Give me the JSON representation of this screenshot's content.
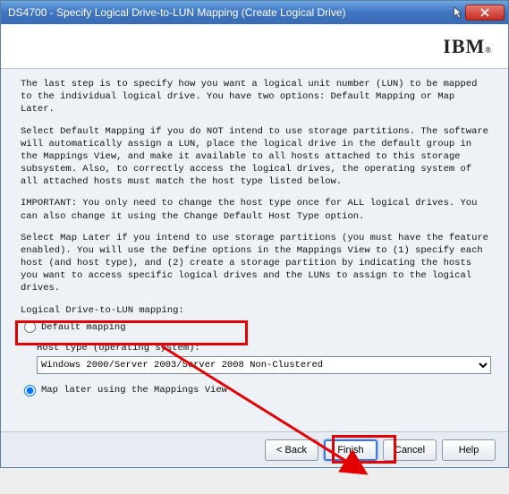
{
  "window": {
    "title": "DS4700 - Specify Logical Drive-to-LUN Mapping (Create Logical Drive)"
  },
  "brand": {
    "logo": "IBM"
  },
  "body": {
    "p1": "The last step is to specify how you want a logical unit number (LUN) to be mapped to the individual logical drive. You have two options: Default Mapping or Map Later.",
    "p2": "Select Default Mapping if you do NOT intend to use storage partitions. The software will automatically assign a LUN, place the logical drive in the default group in the Mappings View, and make it available to all hosts attached to this storage subsystem. Also, to correctly access the logical drives, the operating system of all attached hosts must match the host type listed below.",
    "p3": "IMPORTANT: You only need to change the host type once for ALL logical drives. You can also change it using the Change Default Host Type option.",
    "p4": "Select Map Later if you intend to use storage partitions (you must have the feature enabled). You will use the Define options in the Mappings View to (1) specify each host (and host type), and (2) create a storage partition by indicating the hosts you want to access specific logical drives and the LUNs to assign to the logical drives."
  },
  "form": {
    "section_label": "Logical Drive-to-LUN mapping:",
    "default_mapping_label": "Default mapping",
    "host_type_label": "Host type (operating system):",
    "host_type_value": "Windows 2000/Server 2003/Server 2008 Non-Clustered",
    "map_later_label": "Map later using the Mappings View"
  },
  "footer": {
    "back": "< Back",
    "finish": "Finish",
    "cancel": "Cancel",
    "help": "Help"
  }
}
